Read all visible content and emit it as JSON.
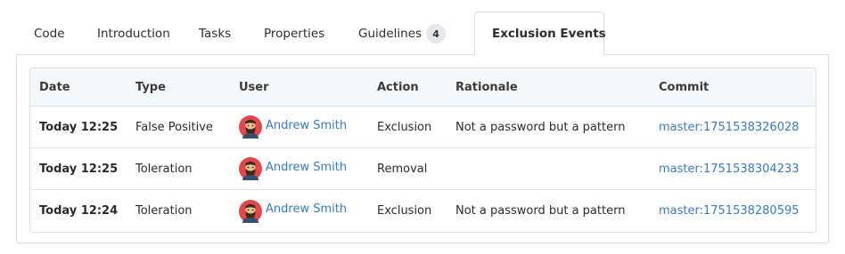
{
  "tabs": [
    {
      "label": "Code"
    },
    {
      "label": "Introduction"
    },
    {
      "label": "Tasks"
    },
    {
      "label": "Properties"
    },
    {
      "label": "Guidelines",
      "badge": "4"
    },
    {
      "label": "Exclusion Events",
      "active": true
    }
  ],
  "table": {
    "columns": [
      "Date",
      "Type",
      "User",
      "Action",
      "Rationale",
      "Commit"
    ],
    "rows": [
      {
        "date": "Today 12:25",
        "type": "False Positive",
        "user": "Andrew Smith",
        "action": "Exclusion",
        "rationale": "Not a password but a pattern",
        "commit": "master:1751538326028"
      },
      {
        "date": "Today 12:25",
        "type": "Toleration",
        "user": "Andrew Smith",
        "action": "Removal",
        "rationale": "",
        "commit": "master:1751538304233"
      },
      {
        "date": "Today 12:24",
        "type": "Toleration",
        "user": "Andrew Smith",
        "action": "Exclusion",
        "rationale": "Not a password but a pattern",
        "commit": "master:1751538280595"
      }
    ]
  },
  "colors": {
    "link": "#3a7bbf",
    "border": "#dcdfe3",
    "header_bg": "#f6f7f8",
    "badge_bg": "#e6e7e9"
  }
}
